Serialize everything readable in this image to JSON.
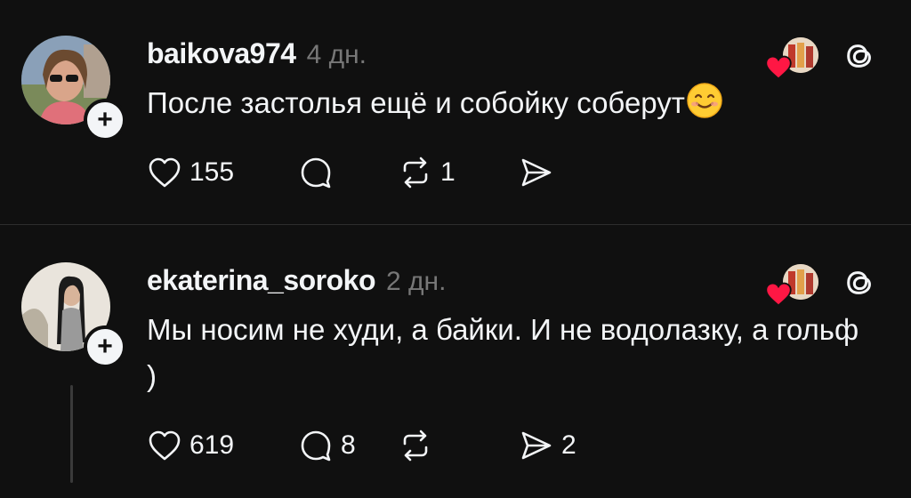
{
  "colors": {
    "background": "#101010",
    "text": "#f3f5f7",
    "muted": "#777777",
    "divider": "#2d2d2d",
    "heart": "#ff1744"
  },
  "posts": [
    {
      "username": "baikova974",
      "time": "4 дн.",
      "text": "После застолья ещё и собойку соберут",
      "text_emoji": "smiling-face-emoji",
      "likes": "155",
      "replies": "",
      "reposts": "1",
      "shares": ""
    },
    {
      "username": "ekaterina_soroko",
      "time": "2 дн.",
      "text": "Мы носим не худи, а байки. И не водолазку, а гольф )",
      "likes": "619",
      "replies": "8",
      "reposts": "",
      "shares": "2"
    }
  ],
  "icons": {
    "like": "heart-icon",
    "reply": "comment-bubble-icon",
    "repost": "repost-icon",
    "share": "send-icon",
    "platform": "threads-icon",
    "follow": "plus-icon"
  }
}
